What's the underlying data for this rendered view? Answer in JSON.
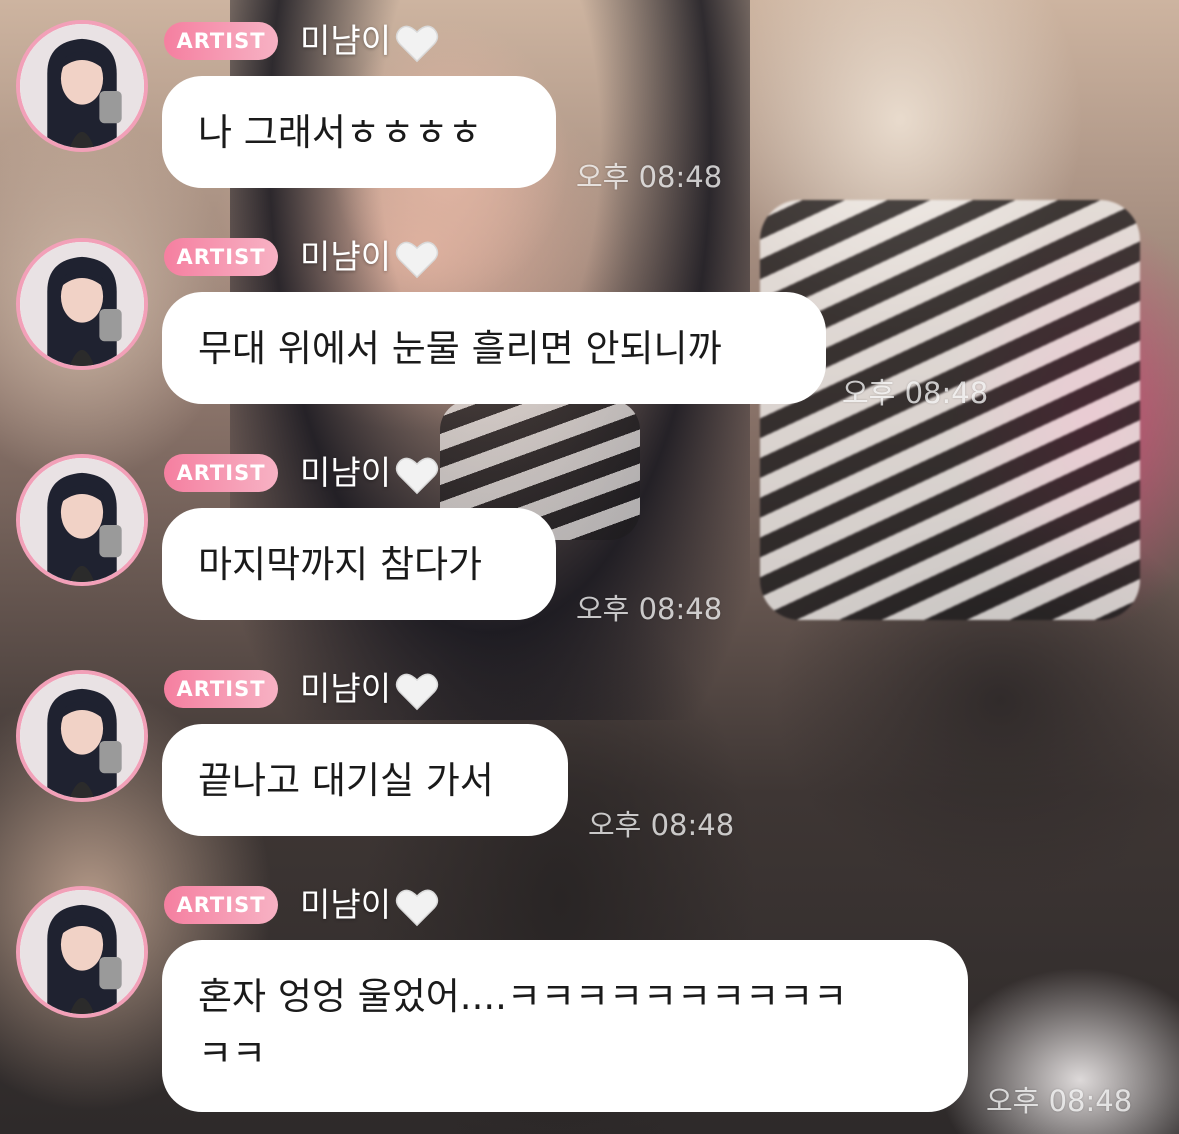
{
  "colors": {
    "badge_start": "#f57fa0",
    "badge_end": "#f7b2c4",
    "avatar_ring": "#f2a0b8",
    "bubble": "#ffffff",
    "text": "#1a1a1a"
  },
  "messages": [
    {
      "badge": "ARTIST",
      "sender": "미냠이",
      "heart_icon": "white-heart-icon",
      "text": "나 그래서ㅎㅎㅎㅎ",
      "time": "오후 08:48"
    },
    {
      "badge": "ARTIST",
      "sender": "미냠이",
      "heart_icon": "white-heart-icon",
      "text": "무대 위에서 눈물 흘리면 안되니까",
      "time": "오후 08:48"
    },
    {
      "badge": "ARTIST",
      "sender": "미냠이",
      "heart_icon": "white-heart-icon",
      "text": "마지막까지 참다가",
      "time": "오후 08:48"
    },
    {
      "badge": "ARTIST",
      "sender": "미냠이",
      "heart_icon": "white-heart-icon",
      "text": "끝나고 대기실 가서",
      "time": "오후 08:48"
    },
    {
      "badge": "ARTIST",
      "sender": "미냠이",
      "heart_icon": "white-heart-icon",
      "text_line1": "혼자 엉엉 울었어....ㅋㅋㅋㅋㅋㅋㅋㅋㅋㅋ",
      "text_line2": "ㅋㅋ",
      "time": "오후 08:48"
    }
  ]
}
